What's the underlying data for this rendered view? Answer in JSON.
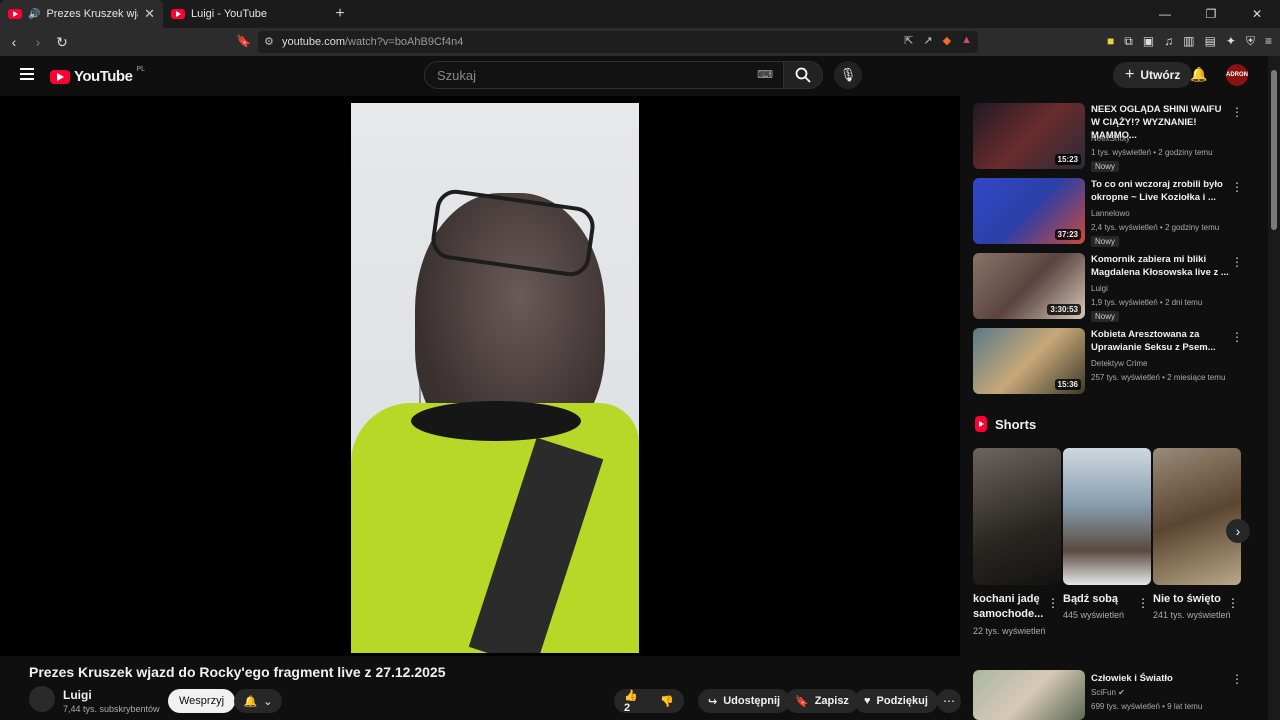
{
  "browser": {
    "tabs": [
      {
        "title": "Prezes Kruszek wjazd do Rocky'ego fragment live",
        "active": true
      },
      {
        "title": "Luigi - YouTube",
        "active": false
      }
    ],
    "url_host": "youtube.com",
    "url_path": "/watch?v=boAhB9Cf4n4"
  },
  "header": {
    "logo_text": "YouTube",
    "region": "PL",
    "search_placeholder": "Szukaj",
    "create_label": "Utwórz",
    "avatar_text": "ADRON"
  },
  "video": {
    "title": "Prezes Kruszek wjazd do Rocky'ego fragment live z 27.12.2025",
    "channel": "Luigi",
    "subscribers": "7,44 tys. subskrybentów",
    "support_label": "Wesprzyj",
    "likes": "2",
    "share_label": "Udostępnij",
    "save_label": "Zapisz",
    "thanks_label": "Podziękuj"
  },
  "recommendations": [
    {
      "title": "NEEX OGLĄDA SHINI WAIFU W CIĄŻY!? WYZNANIE! MAMMO...",
      "channel": "NeexShoty",
      "meta": "1 tys. wyświetleń • 2 godziny temu",
      "badge": "Nowy",
      "duration": "15:23",
      "thumb_color": "#3a1e2e"
    },
    {
      "title": "To co oni wczoraj zrobili było okropne ~ Live Koziołka i ...",
      "channel": "Lannelowo",
      "meta": "2,4 tys. wyświetleń • 2 godziny temu",
      "badge": "Nowy",
      "duration": "37:23",
      "thumb_color": "#2d3a8a"
    },
    {
      "title": "Komornik zabiera mi bliki Magdalena Kłosowska live z ...",
      "channel": "Luigi",
      "meta": "1,9 tys. wyświetleń • 2 dni temu",
      "badge": "Nowy",
      "duration": "3:30:53",
      "thumb_color": "#6a5248"
    },
    {
      "title": "Kobieta Aresztowana za Uprawianie Seksu z Psem...",
      "channel": "Detektyw Crime",
      "meta": "257 tys. wyświetleń • 2 miesiące temu",
      "badge": "",
      "duration": "15:36",
      "thumb_color": "#7a6a4a"
    }
  ],
  "shorts": {
    "heading": "Shorts",
    "items": [
      {
        "title": "kochani jadę samochode...",
        "views": "22 tys. wyświetleń",
        "color": "#3a3530"
      },
      {
        "title": "Bądź sobą",
        "views": "445 wyświetleń",
        "color": "#9fb4c8"
      },
      {
        "title": "Nie to święto",
        "views": "241 tys. wyświetleń",
        "color": "#6b5a48"
      }
    ]
  },
  "bottom_rec": {
    "title": "Człowiek i Światło",
    "channel": "SciFun",
    "meta": "699 tys. wyświetleń • 9 lat temu"
  }
}
